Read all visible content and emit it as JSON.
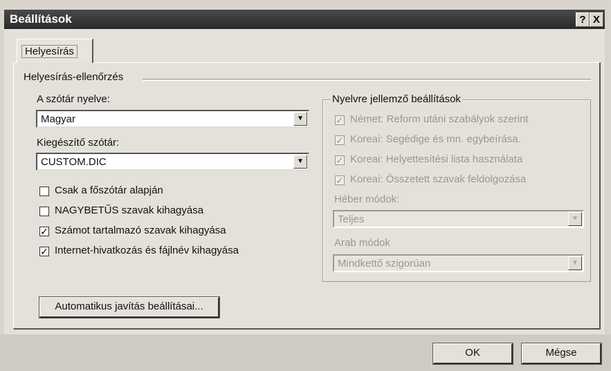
{
  "window": {
    "title": "Beállítások",
    "help_btn": "?",
    "close_btn": "X"
  },
  "tabs": [
    {
      "label": "Helyesírás",
      "selected": true
    }
  ],
  "group": {
    "title": "Helyesírás-ellenőrzés"
  },
  "dictionary_language": {
    "label": "A szótár nyelve:",
    "value": "Magyar"
  },
  "custom_dictionary": {
    "label": "Kiegészítő szótár:",
    "value": "CUSTOM.DIC"
  },
  "options": [
    {
      "label": "Csak a főszótár alapján",
      "checked": false
    },
    {
      "label": "NAGYBETŰS szavak kihagyása",
      "checked": false
    },
    {
      "label": "Számot tartalmazó szavak kihagyása",
      "checked": true
    },
    {
      "label": "Internet-hivatkozás és fájlnév kihagyása",
      "checked": true
    }
  ],
  "autocorrect_button": "Automatikus javítás beállításai...",
  "language_settings": {
    "title": "Nyelvre jellemző beállítások",
    "items": [
      {
        "label": "Német: Reform utáni szabályok szerint",
        "checked": true
      },
      {
        "label": "Koreai: Segédige és mn. egybeírása.",
        "checked": true
      },
      {
        "label": "Koreai: Helyettesítési lista használata",
        "checked": true
      },
      {
        "label": "Koreai: Összetett szavak feldolgozása",
        "checked": true
      }
    ],
    "hebrew": {
      "label": "Héber módok:",
      "value": "Teljes"
    },
    "arabic": {
      "label": "Arab módok",
      "value": "Mindkettő szigorúan"
    }
  },
  "ok_button": "OK",
  "cancel_button": "Mégse"
}
